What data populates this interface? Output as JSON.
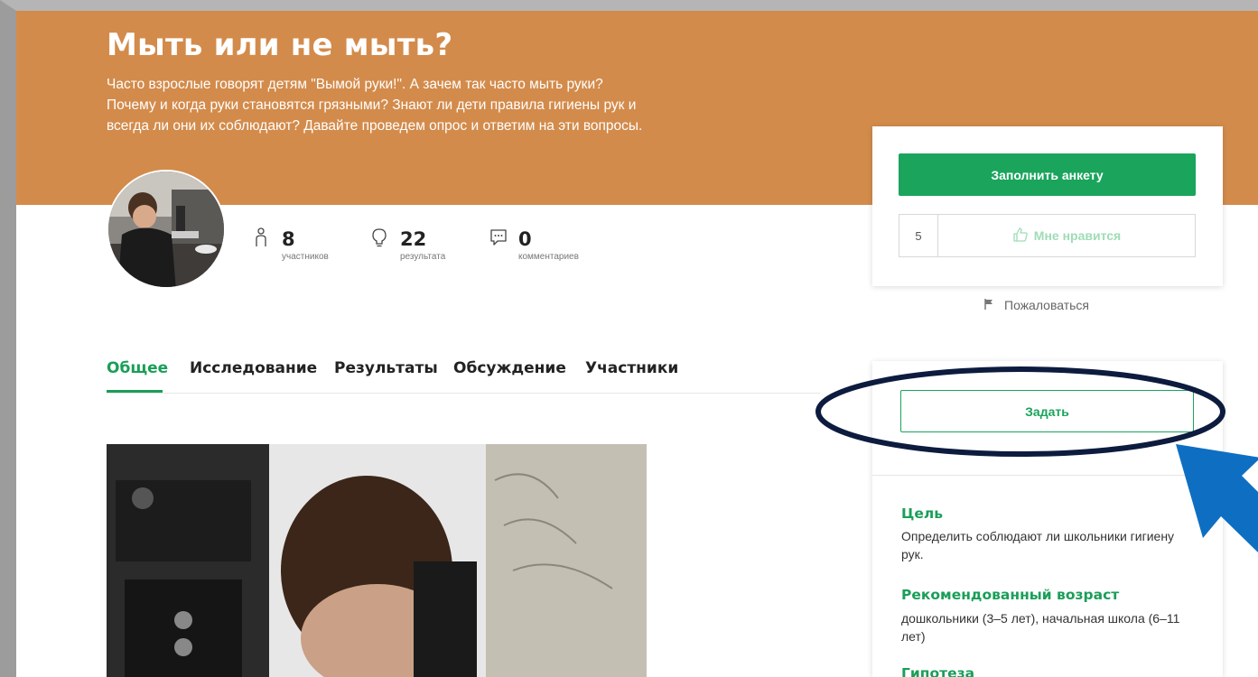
{
  "project": {
    "title": "Мыть или не мыть?",
    "description": "Часто взрослые говорят детям \"Вымой руки!\". А зачем так часто мыть руки? Почему и когда руки становятся грязными? Знают ли дети правила гигиены рук и всегда ли они их соблюдают? Давайте проведем опрос и ответим на эти вопросы."
  },
  "stats": [
    {
      "icon": "person-icon",
      "value": "8",
      "label": "участников"
    },
    {
      "icon": "lightbulb-icon",
      "value": "22",
      "label": "результата"
    },
    {
      "icon": "comment-icon",
      "value": "0",
      "label": "комментариев"
    }
  ],
  "tabs": [
    {
      "label": "Общее",
      "active": true
    },
    {
      "label": "Исследование",
      "active": false
    },
    {
      "label": "Результаты",
      "active": false
    },
    {
      "label": "Обсуждение",
      "active": false
    },
    {
      "label": "Участники",
      "active": false
    }
  ],
  "actions": {
    "fill_label": "Заполнить анкету",
    "like_count": "5",
    "like_label": "Мне нравится",
    "complain_label": "Пожаловаться",
    "ask_label": "Задать"
  },
  "info": [
    {
      "heading": "Цель",
      "text": "Определить соблюдают ли школьники гигиену рук."
    },
    {
      "heading": "Рекомендованный возраст",
      "text": "дошкольники (3–5 лет), начальная школа (6–11 лет)"
    },
    {
      "heading": "Гипотеза",
      "text": ""
    }
  ],
  "colors": {
    "banner": "#d38b4b",
    "accent_green": "#1aa45c",
    "annotation_dark": "#0d1b3e",
    "annotation_blue": "#0e6fc2"
  }
}
